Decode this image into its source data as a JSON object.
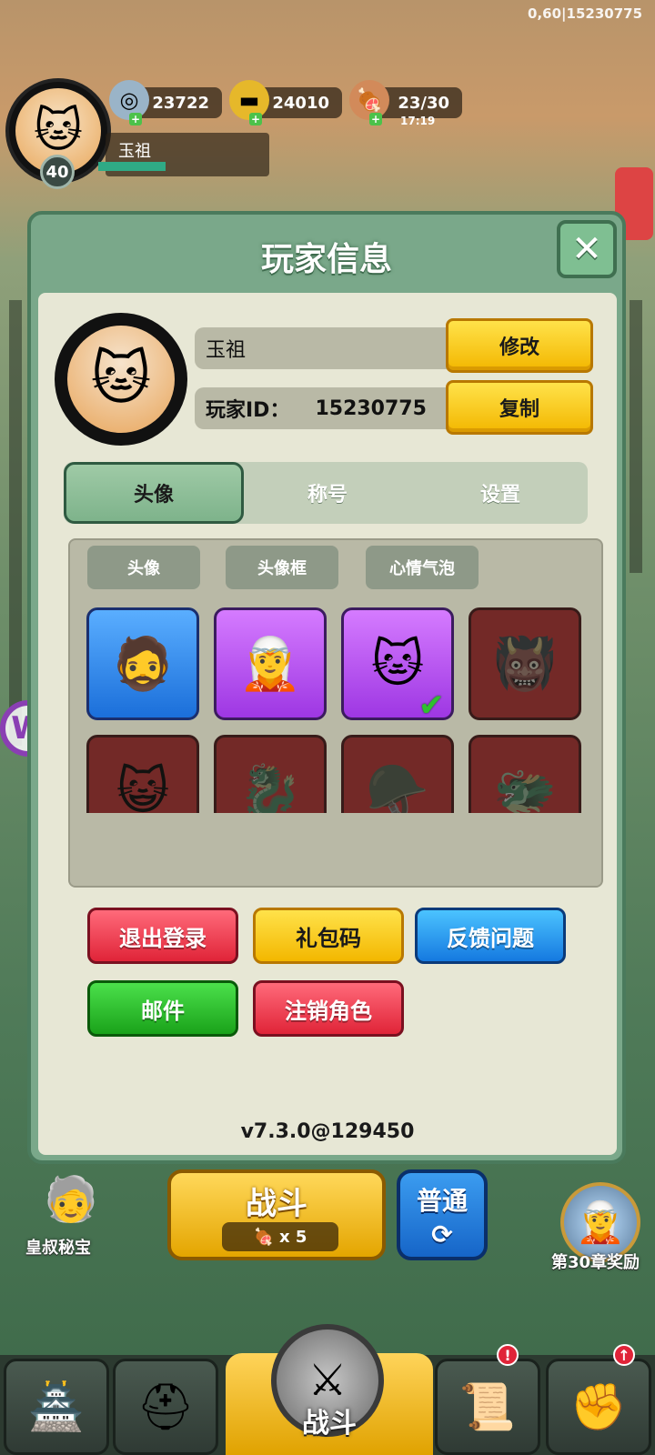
{
  "debug": "0,60|15230775",
  "hud": {
    "level": "40",
    "player_name": "玉祖",
    "silver": "23722",
    "gold": "24010",
    "stamina": "23/30",
    "stamina_timer": "17:19",
    "silver_icon": "silver-coin-icon",
    "gold_icon": "gold-ingot-icon",
    "stamina_icon": "meat-icon"
  },
  "dialog": {
    "title": "玩家信息",
    "close_icon": "close-icon",
    "profile": {
      "name": "玉祖",
      "id_label": "玩家ID：",
      "id_value": "15230775",
      "modify_label": "修改",
      "copy_label": "复制"
    },
    "tabs": [
      {
        "label": "头像",
        "active": true
      },
      {
        "label": "称号",
        "active": false
      },
      {
        "label": "设置",
        "active": false
      }
    ],
    "subtabs": [
      {
        "label": "头像"
      },
      {
        "label": "头像框"
      },
      {
        "label": "心情气泡"
      }
    ],
    "avatars": [
      {
        "icon": "hero-soldier-icon",
        "style": "blue",
        "locked": false,
        "selected": false
      },
      {
        "icon": "hero-mage-icon",
        "style": "purple",
        "locked": false,
        "selected": false
      },
      {
        "icon": "lucky-cat-icon",
        "style": "purple",
        "locked": false,
        "selected": true
      },
      {
        "icon": "warrior-mask-icon",
        "style": "locked",
        "locked": true,
        "selected": false
      },
      {
        "icon": "cat-icon",
        "style": "locked",
        "locked": true,
        "selected": false
      },
      {
        "icon": "dragon-icon",
        "style": "locked",
        "locked": true,
        "selected": false
      },
      {
        "icon": "general-icon",
        "style": "locked",
        "locked": true,
        "selected": false
      },
      {
        "icon": "beast-icon",
        "style": "locked",
        "locked": true,
        "selected": false
      }
    ],
    "buttons": {
      "logout": "退出登录",
      "gift_code": "礼包码",
      "feedback": "反馈问题",
      "mail": "邮件",
      "delete_role": "注销角色"
    },
    "version": "v7.3.0@129450"
  },
  "bottom": {
    "battle_label": "战斗",
    "battle_cost": "x 5",
    "mode_label": "普通",
    "secret_label": "皇叔秘宝",
    "reward_label": "第30章奖励",
    "nav_center_label": "战斗"
  },
  "colors": {
    "dialog_frame": "#7aa88a",
    "panel_bg": "#e7e7d5",
    "accent_yellow": "#f3b700",
    "accent_red": "#e02438",
    "accent_blue": "#1579e0",
    "accent_green": "#1aa21a"
  }
}
